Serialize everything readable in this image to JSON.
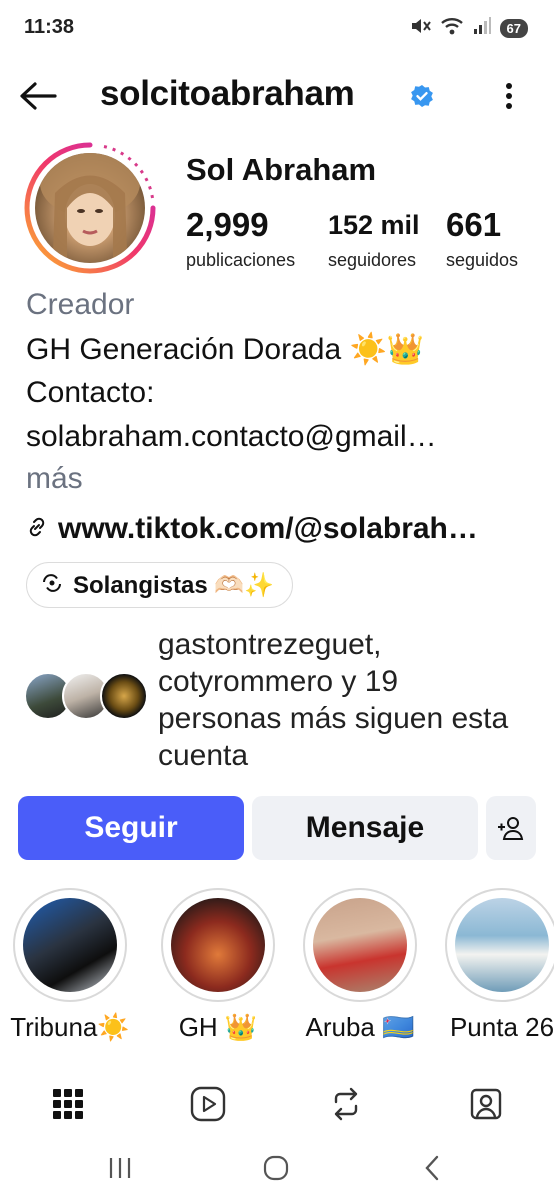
{
  "status_bar": {
    "time": "11:38",
    "battery": "67"
  },
  "header": {
    "username": "solcitoabraham"
  },
  "profile": {
    "full_name": "Sol Abraham",
    "stats": [
      {
        "value": "2,999",
        "label": "publicaciones"
      },
      {
        "value": "152 mil",
        "label": "seguidores"
      },
      {
        "value": "661",
        "label": "seguidos"
      }
    ],
    "category": "Creador",
    "bio_lines": [
      "GH Generación Dorada ☀️👑",
      "Contacto:",
      "solabraham.contacto@gmail…"
    ],
    "more": "más",
    "link": "www.tiktok.com/@solabrah…",
    "channel": "Solangistas 🫶🏻✨",
    "followed_by": "gastontrezeguet, cotyrommero y 19 personas más siguen esta cuenta"
  },
  "actions": {
    "follow": "Seguir",
    "message": "Mensaje"
  },
  "highlights": [
    {
      "label": "Tribuna☀️"
    },
    {
      "label": "GH 👑"
    },
    {
      "label": "Aruba 🇦🇼"
    },
    {
      "label": "Punta 26"
    }
  ],
  "icons": {
    "back": "arrow-left-icon",
    "verified": "verified-badge-icon",
    "more": "more-vertical-icon",
    "grid": "grid-icon",
    "reels": "reels-icon",
    "reposts": "repost-icon",
    "tagged": "tagged-icon"
  },
  "colors": {
    "accent": "#4a5df9",
    "verified": "#3897f0",
    "secondary_text": "#6b7280"
  }
}
